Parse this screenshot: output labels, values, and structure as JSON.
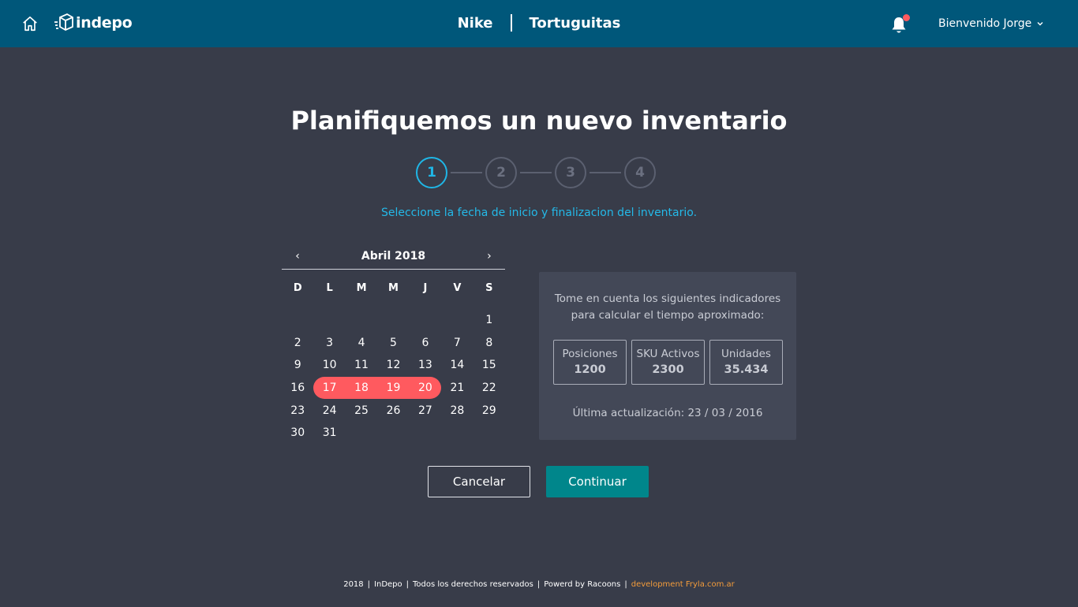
{
  "header": {
    "logo_text": "indepo",
    "brands": [
      "Nike",
      "Tortuguitas"
    ],
    "user_greeting": "Bienvenido Jorge"
  },
  "title": "Planifiquemos un nuevo inventario",
  "stepper": {
    "steps": [
      "1",
      "2",
      "3",
      "4"
    ],
    "active": 1
  },
  "instruction": "Seleccione la fecha de inicio y finalizacion del inventario.",
  "calendar": {
    "month_label": "Abril 2018",
    "prev": "‹",
    "next": "›",
    "weekdays": [
      "D",
      "L",
      "M",
      "M",
      "J",
      "V",
      "S"
    ],
    "first_weekday": 6,
    "days": 31,
    "selected_range": [
      17,
      20
    ]
  },
  "panel": {
    "line1": "Tome en cuenta los siguientes indicadores",
    "line2": "para calcular el tiempo aproximado:",
    "stats": [
      {
        "label": "Posiciones",
        "value": "1200"
      },
      {
        "label": "SKU Activos",
        "value": "2300"
      },
      {
        "label": "Unidades",
        "value": "35.434"
      }
    ],
    "updated": "Última actualización: 23 / 03 / 2016"
  },
  "actions": {
    "cancel": "Cancelar",
    "continue": "Continuar"
  },
  "footer": {
    "year": "2018",
    "company": "InDepo",
    "rights": "Todos los derechos reservados",
    "powered": "Powerd by Racoons",
    "dev": "development Fryla.com.ar"
  },
  "colors": {
    "header": "#00577a",
    "accent": "#1fb6e6",
    "selected": "#ff5a5f",
    "primary_button": "#00868b",
    "dev_link": "#f39c3b"
  }
}
